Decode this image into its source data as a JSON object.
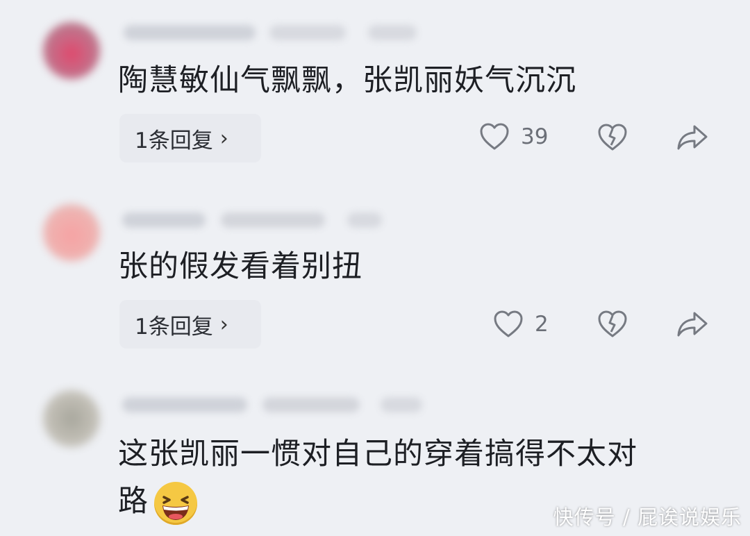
{
  "comments": [
    {
      "text": "陶慧敏仙气飘飘，张凯丽妖气沉沉",
      "reply_label": "1条回复",
      "like_count": "39",
      "avatar_color": "#d6577a"
    },
    {
      "text": "张的假发看着别扭",
      "reply_label": "1条回复",
      "like_count": "2",
      "avatar_color": "#f0a7a9"
    },
    {
      "text_line1": "这张凯丽一惯对自己的穿着搞得不太对",
      "text_line2": "路",
      "avatar_color": "#b9b6ad",
      "emoji": "grinning-squinting-face"
    }
  ],
  "icons": {
    "like": "heart-icon",
    "dislike": "broken-heart-icon",
    "share": "share-arrow-icon"
  },
  "watermark": "快传号 / 屁诶说娱乐"
}
